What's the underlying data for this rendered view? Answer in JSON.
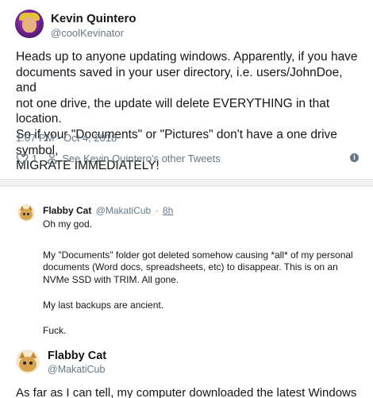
{
  "main_tweet": {
    "display_name": "Kevin Quintero",
    "handle": "@coolKevinator",
    "text_lines": [
      "Heads up to anyone updating windows. Apparently, if you have",
      "documents saved in your user directory, i.e. users/JohnDoe, and",
      "not one drive, the update will delete EVERYTHING in that location.",
      "So if your \"Documents\" or \"Pictures\" don't have a one drive symbol,",
      "MIGRATE IMMEDIATELY!"
    ],
    "timestamp": "1:07 PM - Oct 4, 2018",
    "like_count": "1",
    "other_tweets_link": "See Kevin Quintero's other Tweets",
    "icons": [
      "heart-icon",
      "person-icon",
      "info-icon"
    ]
  },
  "reply": {
    "display_name": "Flabby Cat",
    "handle": "@MakatiCub",
    "separator": "·",
    "time": "8h",
    "paragraphs": [
      "Oh my god.",
      "My \"Documents\" folder got deleted somehow causing *all* of my personal documents (Word docs, spreadsheets, etc) to disappear. This is on an NVMe SSD with TRIM. All gone.",
      "My last backups are ancient.",
      "Fuck."
    ]
  },
  "quoted_tweet": {
    "display_name": "Flabby Cat",
    "handle": "@MakatiCub",
    "text": "As far as I can tell, my computer downloaded the latest Windows"
  },
  "colors": {
    "text": "#14171a",
    "muted": "#657786",
    "background": "#f0f0f0",
    "card": "#ffffff"
  }
}
